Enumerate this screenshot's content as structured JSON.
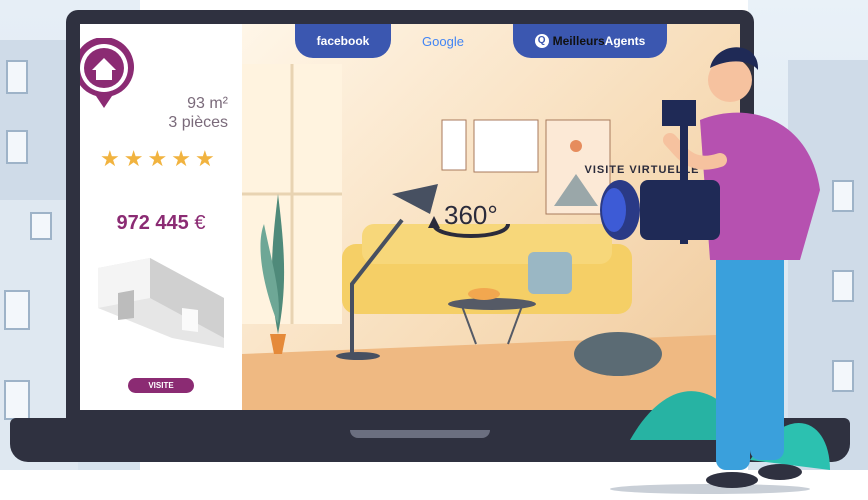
{
  "tabs": {
    "facebook": "facebook",
    "google": "Google",
    "meilleurs_prefix": "Meilleurs",
    "meilleurs_suffix": "Agents"
  },
  "listing": {
    "area": "93 m²",
    "rooms": "3 pièces",
    "rating_stars": 5,
    "price": "972 445",
    "currency": "€",
    "visit_button": "VISITE"
  },
  "tour": {
    "label": "VISITE VIRTUELLE",
    "degrees": "360°"
  },
  "colors": {
    "brand": "#8b2b73",
    "tab_blue": "#3b57b0",
    "star": "#f1b33f"
  }
}
